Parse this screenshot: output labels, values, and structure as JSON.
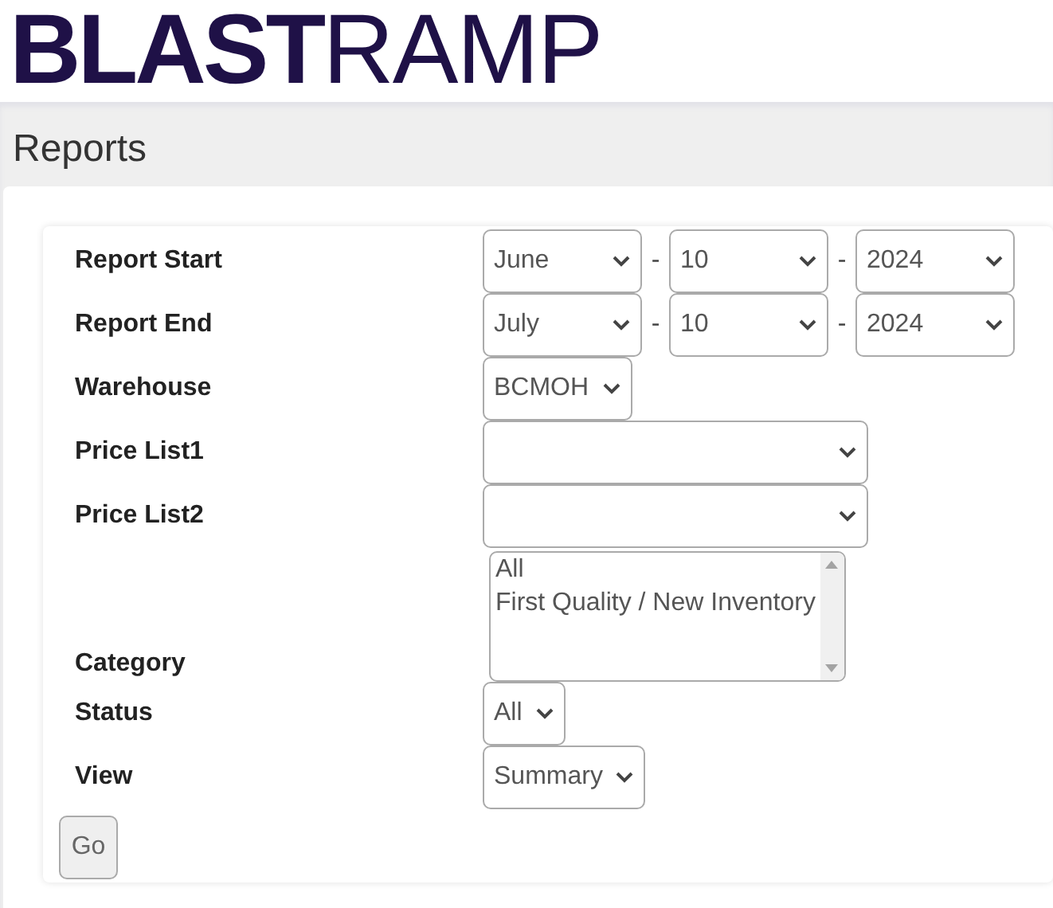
{
  "logo": "**BLAST**RAMP",
  "page_title": "Reports",
  "form": [
    {
      "label": "Report Start",
      "controls": [
        {
          "kind": "select",
          "value": "June"
        },
        {
          "kind": "separator",
          "text": "-"
        },
        {
          "kind": "select",
          "value": "10"
        },
        {
          "kind": "separator",
          "text": "-"
        },
        {
          "kind": "select",
          "value": "2024"
        }
      ]
    },
    {
      "label": "Report End",
      "controls": [
        {
          "kind": "select",
          "value": "July"
        },
        {
          "kind": "separator",
          "text": "-"
        },
        {
          "kind": "select",
          "value": "10"
        },
        {
          "kind": "separator",
          "text": "-"
        },
        {
          "kind": "select",
          "value": "2024"
        }
      ]
    },
    {
      "label": "Warehouse",
      "controls": [
        {
          "kind": "select",
          "value": "BCMOH"
        }
      ]
    },
    {
      "label": "Price List1",
      "controls": [
        {
          "kind": "select"
        }
      ]
    },
    {
      "label": "Price List2",
      "controls": [
        {
          "kind": "select"
        }
      ]
    },
    {
      "label": "Category",
      "controls": [
        {
          "kind": "listbox",
          "options": [
            "All",
            "First Quality / New Inventory"
          ]
        }
      ]
    },
    {
      "label": "Status",
      "controls": [
        {
          "kind": "select",
          "value": "All"
        }
      ]
    },
    {
      "label": "View",
      "controls": [
        {
          "kind": "select",
          "value": "Summary"
        }
      ]
    }
  ],
  "submit": "Go"
}
